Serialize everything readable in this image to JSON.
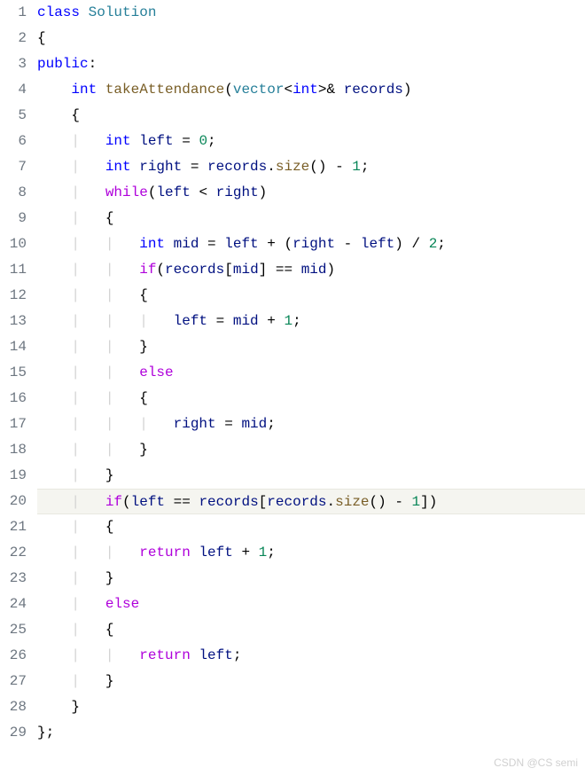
{
  "code": {
    "lines": [
      {
        "num": "1",
        "tokens": [
          {
            "t": "class ",
            "c": "kw"
          },
          {
            "t": "Solution",
            "c": "cls"
          }
        ]
      },
      {
        "num": "2",
        "tokens": [
          {
            "t": "{",
            "c": "punct"
          }
        ]
      },
      {
        "num": "3",
        "tokens": [
          {
            "t": "public",
            "c": "kw"
          },
          {
            "t": ":",
            "c": "punct"
          }
        ]
      },
      {
        "num": "4",
        "tokens": [
          {
            "t": "    ",
            "c": ""
          },
          {
            "t": "int ",
            "c": "type"
          },
          {
            "t": "takeAttendance",
            "c": "fn"
          },
          {
            "t": "(",
            "c": "paren"
          },
          {
            "t": "vector",
            "c": "cls"
          },
          {
            "t": "<",
            "c": "punct"
          },
          {
            "t": "int",
            "c": "type"
          },
          {
            "t": ">& ",
            "c": "punct"
          },
          {
            "t": "records",
            "c": "ident"
          },
          {
            "t": ")",
            "c": "paren"
          }
        ]
      },
      {
        "num": "5",
        "tokens": [
          {
            "t": "    ",
            "c": ""
          },
          {
            "t": "{",
            "c": "punct"
          }
        ]
      },
      {
        "num": "6",
        "tokens": [
          {
            "t": "    ",
            "c": ""
          },
          {
            "t": "|   ",
            "c": "guide"
          },
          {
            "t": "int ",
            "c": "type"
          },
          {
            "t": "left ",
            "c": "ident"
          },
          {
            "t": "= ",
            "c": "op"
          },
          {
            "t": "0",
            "c": "num"
          },
          {
            "t": ";",
            "c": "punct"
          }
        ]
      },
      {
        "num": "7",
        "tokens": [
          {
            "t": "    ",
            "c": ""
          },
          {
            "t": "|   ",
            "c": "guide"
          },
          {
            "t": "int ",
            "c": "type"
          },
          {
            "t": "right ",
            "c": "ident"
          },
          {
            "t": "= ",
            "c": "op"
          },
          {
            "t": "records",
            "c": "ident"
          },
          {
            "t": ".",
            "c": "punct"
          },
          {
            "t": "size",
            "c": "fn"
          },
          {
            "t": "() - ",
            "c": "punct"
          },
          {
            "t": "1",
            "c": "num"
          },
          {
            "t": ";",
            "c": "punct"
          }
        ]
      },
      {
        "num": "8",
        "tokens": [
          {
            "t": "    ",
            "c": ""
          },
          {
            "t": "|   ",
            "c": "guide"
          },
          {
            "t": "while",
            "c": "ctrl"
          },
          {
            "t": "(",
            "c": "paren"
          },
          {
            "t": "left ",
            "c": "ident"
          },
          {
            "t": "< ",
            "c": "op"
          },
          {
            "t": "right",
            "c": "ident"
          },
          {
            "t": ")",
            "c": "paren"
          }
        ]
      },
      {
        "num": "9",
        "tokens": [
          {
            "t": "    ",
            "c": ""
          },
          {
            "t": "|   ",
            "c": "guide"
          },
          {
            "t": "{",
            "c": "punct"
          }
        ]
      },
      {
        "num": "10",
        "tokens": [
          {
            "t": "    ",
            "c": ""
          },
          {
            "t": "|   |   ",
            "c": "guide"
          },
          {
            "t": "int ",
            "c": "type"
          },
          {
            "t": "mid ",
            "c": "ident"
          },
          {
            "t": "= ",
            "c": "op"
          },
          {
            "t": "left ",
            "c": "ident"
          },
          {
            "t": "+ (",
            "c": "punct"
          },
          {
            "t": "right ",
            "c": "ident"
          },
          {
            "t": "- ",
            "c": "op"
          },
          {
            "t": "left",
            "c": "ident"
          },
          {
            "t": ") / ",
            "c": "punct"
          },
          {
            "t": "2",
            "c": "num"
          },
          {
            "t": ";",
            "c": "punct"
          }
        ]
      },
      {
        "num": "11",
        "tokens": [
          {
            "t": "    ",
            "c": ""
          },
          {
            "t": "|   |   ",
            "c": "guide"
          },
          {
            "t": "if",
            "c": "ctrl"
          },
          {
            "t": "(",
            "c": "paren"
          },
          {
            "t": "records",
            "c": "ident"
          },
          {
            "t": "[",
            "c": "punct"
          },
          {
            "t": "mid",
            "c": "ident"
          },
          {
            "t": "] == ",
            "c": "punct"
          },
          {
            "t": "mid",
            "c": "ident"
          },
          {
            "t": ")",
            "c": "paren"
          }
        ]
      },
      {
        "num": "12",
        "tokens": [
          {
            "t": "    ",
            "c": ""
          },
          {
            "t": "|   |   ",
            "c": "guide"
          },
          {
            "t": "{",
            "c": "punct"
          }
        ]
      },
      {
        "num": "13",
        "tokens": [
          {
            "t": "    ",
            "c": ""
          },
          {
            "t": "|   |   |   ",
            "c": "guide"
          },
          {
            "t": "left ",
            "c": "ident"
          },
          {
            "t": "= ",
            "c": "op"
          },
          {
            "t": "mid ",
            "c": "ident"
          },
          {
            "t": "+ ",
            "c": "op"
          },
          {
            "t": "1",
            "c": "num"
          },
          {
            "t": ";",
            "c": "punct"
          }
        ]
      },
      {
        "num": "14",
        "tokens": [
          {
            "t": "    ",
            "c": ""
          },
          {
            "t": "|   |   ",
            "c": "guide"
          },
          {
            "t": "}",
            "c": "punct"
          }
        ]
      },
      {
        "num": "15",
        "tokens": [
          {
            "t": "    ",
            "c": ""
          },
          {
            "t": "|   |   ",
            "c": "guide"
          },
          {
            "t": "else",
            "c": "ctrl"
          }
        ]
      },
      {
        "num": "16",
        "tokens": [
          {
            "t": "    ",
            "c": ""
          },
          {
            "t": "|   |   ",
            "c": "guide"
          },
          {
            "t": "{",
            "c": "punct"
          }
        ]
      },
      {
        "num": "17",
        "tokens": [
          {
            "t": "    ",
            "c": ""
          },
          {
            "t": "|   |   |   ",
            "c": "guide"
          },
          {
            "t": "right ",
            "c": "ident"
          },
          {
            "t": "= ",
            "c": "op"
          },
          {
            "t": "mid",
            "c": "ident"
          },
          {
            "t": ";",
            "c": "punct"
          }
        ]
      },
      {
        "num": "18",
        "tokens": [
          {
            "t": "    ",
            "c": ""
          },
          {
            "t": "|   |   ",
            "c": "guide"
          },
          {
            "t": "}",
            "c": "punct"
          }
        ]
      },
      {
        "num": "19",
        "tokens": [
          {
            "t": "    ",
            "c": ""
          },
          {
            "t": "|   ",
            "c": "guide"
          },
          {
            "t": "}",
            "c": "punct"
          }
        ]
      },
      {
        "num": "20",
        "tokens": [
          {
            "t": "    ",
            "c": ""
          },
          {
            "t": "|   ",
            "c": "guide"
          },
          {
            "t": "if",
            "c": "ctrl"
          },
          {
            "t": "(",
            "c": "paren"
          },
          {
            "t": "left ",
            "c": "ident"
          },
          {
            "t": "== ",
            "c": "op"
          },
          {
            "t": "records",
            "c": "ident"
          },
          {
            "t": "[",
            "c": "punct"
          },
          {
            "t": "records",
            "c": "ident"
          },
          {
            "t": ".",
            "c": "punct"
          },
          {
            "t": "size",
            "c": "fn"
          },
          {
            "t": "() - ",
            "c": "punct"
          },
          {
            "t": "1",
            "c": "num"
          },
          {
            "t": "])",
            "c": "punct"
          }
        ],
        "highlighted": true
      },
      {
        "num": "21",
        "tokens": [
          {
            "t": "    ",
            "c": ""
          },
          {
            "t": "|   ",
            "c": "guide"
          },
          {
            "t": "{",
            "c": "punct"
          }
        ]
      },
      {
        "num": "22",
        "tokens": [
          {
            "t": "    ",
            "c": ""
          },
          {
            "t": "|   |   ",
            "c": "guide"
          },
          {
            "t": "return ",
            "c": "ctrl"
          },
          {
            "t": "left ",
            "c": "ident"
          },
          {
            "t": "+ ",
            "c": "op"
          },
          {
            "t": "1",
            "c": "num"
          },
          {
            "t": ";",
            "c": "punct"
          }
        ]
      },
      {
        "num": "23",
        "tokens": [
          {
            "t": "    ",
            "c": ""
          },
          {
            "t": "|   ",
            "c": "guide"
          },
          {
            "t": "}",
            "c": "punct"
          }
        ]
      },
      {
        "num": "24",
        "tokens": [
          {
            "t": "    ",
            "c": ""
          },
          {
            "t": "|   ",
            "c": "guide"
          },
          {
            "t": "else",
            "c": "ctrl"
          }
        ]
      },
      {
        "num": "25",
        "tokens": [
          {
            "t": "    ",
            "c": ""
          },
          {
            "t": "|   ",
            "c": "guide"
          },
          {
            "t": "{",
            "c": "punct"
          }
        ]
      },
      {
        "num": "26",
        "tokens": [
          {
            "t": "    ",
            "c": ""
          },
          {
            "t": "|   |   ",
            "c": "guide"
          },
          {
            "t": "return ",
            "c": "ctrl"
          },
          {
            "t": "left",
            "c": "ident"
          },
          {
            "t": ";",
            "c": "punct"
          }
        ]
      },
      {
        "num": "27",
        "tokens": [
          {
            "t": "    ",
            "c": ""
          },
          {
            "t": "|   ",
            "c": "guide"
          },
          {
            "t": "}",
            "c": "punct"
          }
        ]
      },
      {
        "num": "28",
        "tokens": [
          {
            "t": "    ",
            "c": ""
          },
          {
            "t": "}",
            "c": "punct"
          }
        ]
      },
      {
        "num": "29",
        "tokens": [
          {
            "t": "};",
            "c": "punct"
          }
        ]
      }
    ]
  },
  "watermark": "CSDN @CS semi"
}
